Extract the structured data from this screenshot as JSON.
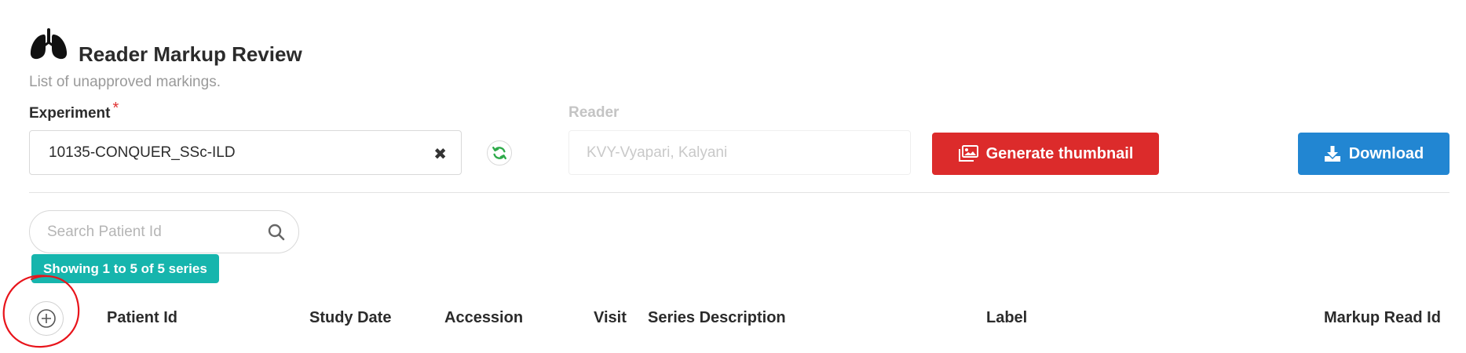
{
  "header": {
    "icon": "lungs-icon",
    "title": "Reader Markup Review",
    "subtitle": "List of unapproved markings."
  },
  "experiment": {
    "label": "Experiment",
    "required_mark": "*",
    "value": "10135-CONQUER_SSc-ILD",
    "clear_icon": "close-icon",
    "refresh_icon": "refresh-icon"
  },
  "reader": {
    "label": "Reader",
    "value": "KVY-Vyapari, Kalyani"
  },
  "actions": {
    "thumbnail_label": "Generate thumbnail",
    "thumbnail_icon": "images-icon",
    "download_label": "Download",
    "download_icon": "download-icon"
  },
  "search": {
    "placeholder": "Search Patient Id",
    "value": ""
  },
  "results": {
    "count_text": "Showing 1 to 5 of 5 series"
  },
  "table": {
    "expand_icon": "plus-circle-icon",
    "columns": [
      "Patient Id",
      "Study Date",
      "Accession",
      "Visit",
      "Series Description",
      "Label",
      "Markup Read Id"
    ]
  },
  "colors": {
    "danger": "#dc2b2b",
    "primary": "#2286d2",
    "teal": "#16b5ad",
    "annotation": "#e8141b"
  }
}
